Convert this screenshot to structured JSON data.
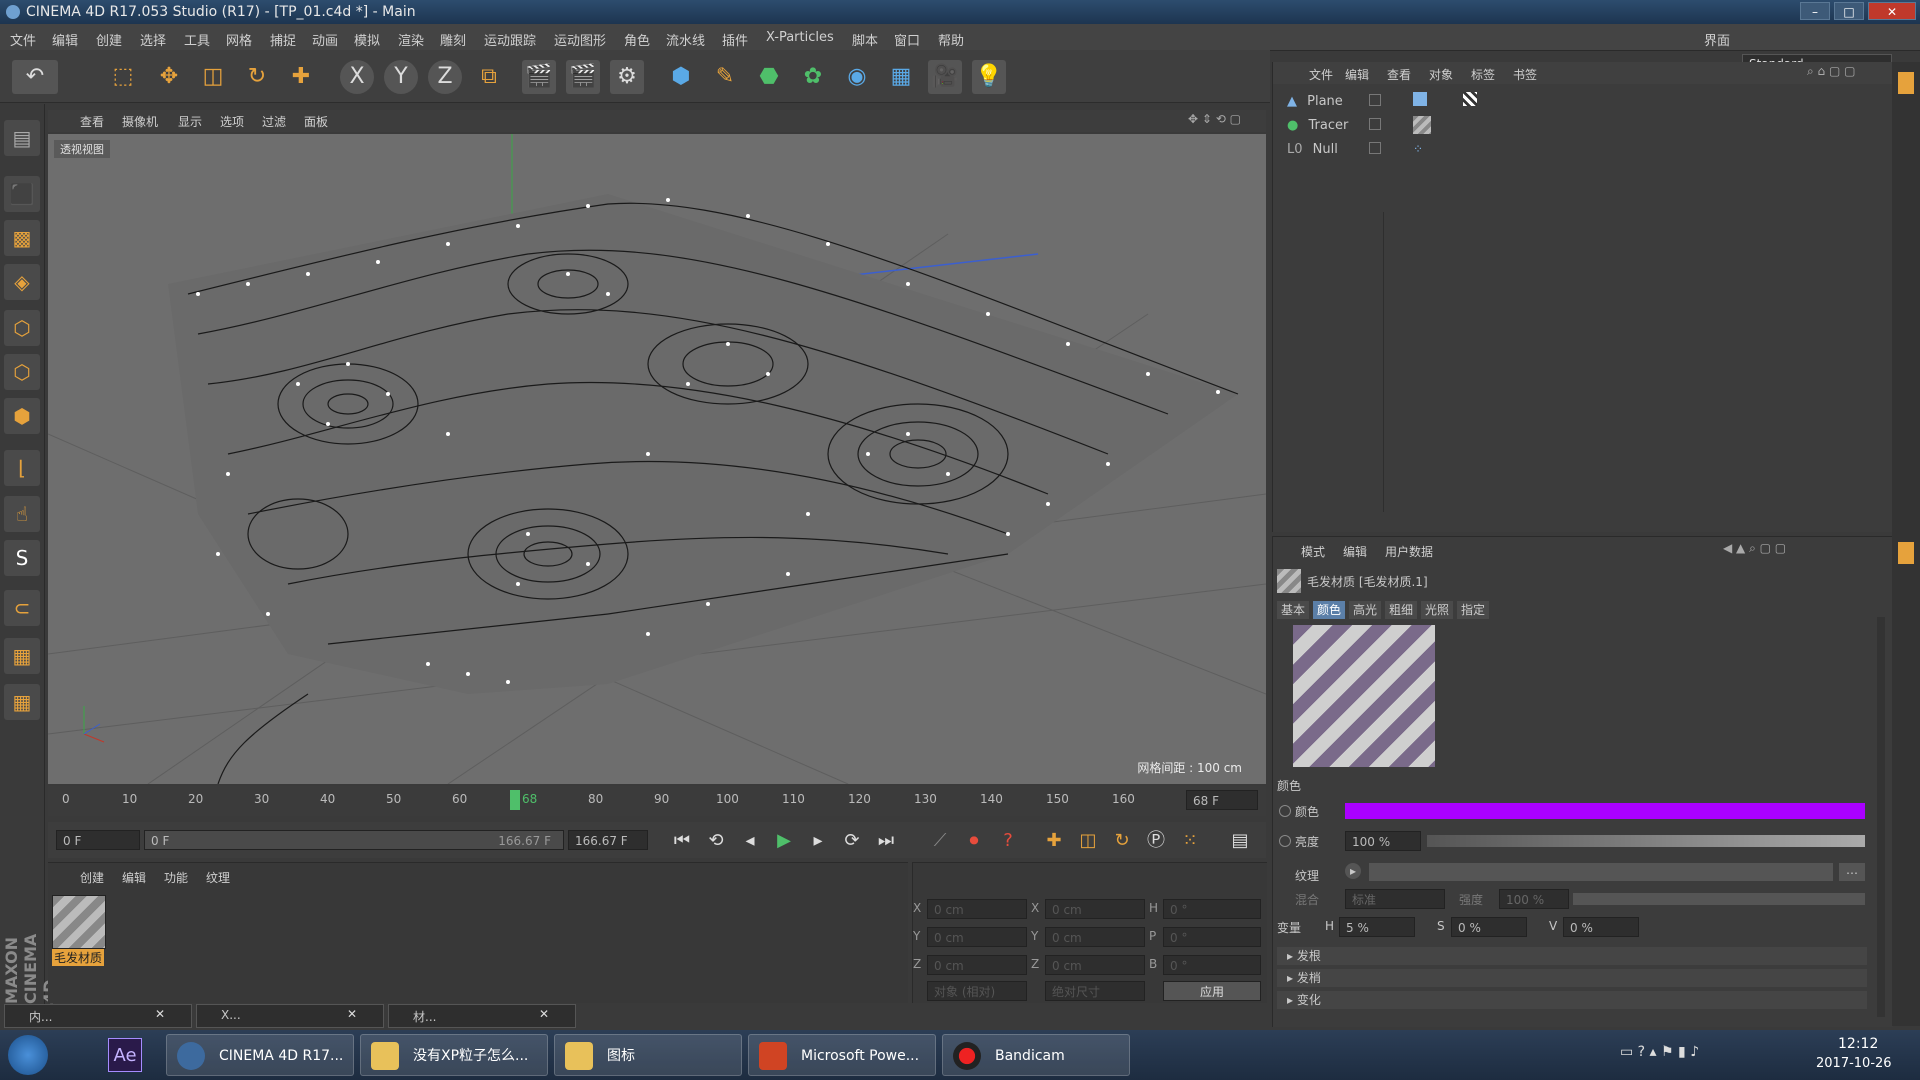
{
  "window": {
    "title": "CINEMA 4D R17.053 Studio (R17) - [TP_01.c4d *] - Main",
    "layout_label": "界面",
    "layout_value": "Standard"
  },
  "menu": [
    "文件",
    "编辑",
    "创建",
    "选择",
    "工具",
    "网格",
    "捕捉",
    "动画",
    "模拟",
    "渲染",
    "雕刻",
    "运动跟踪",
    "运动图形",
    "角色",
    "流水线",
    "插件",
    "X-Particles",
    "脚本",
    "窗口",
    "帮助"
  ],
  "viewport": {
    "menu": [
      "查看",
      "摄像机",
      "显示",
      "选项",
      "过滤",
      "面板"
    ],
    "label": "透视视图",
    "grid_info": "网格间距 : 100 cm"
  },
  "timeline": {
    "ticks": [
      "0",
      "10",
      "20",
      "30",
      "40",
      "50",
      "60",
      "68",
      "80",
      "90",
      "100",
      "110",
      "120",
      "130",
      "140",
      "150",
      "160"
    ],
    "end_frame": "68 F",
    "current": "0 F",
    "range_left": "0 F",
    "range_right": "166.67 F",
    "range_end": "166.67 F"
  },
  "material_manager": {
    "menu": [
      "创建",
      "编辑",
      "功能",
      "纹理"
    ],
    "material_name": "毛发材质"
  },
  "coords": {
    "labels": [
      "X",
      "Y",
      "Z",
      "X",
      "Y",
      "Z",
      "H",
      "P",
      "B"
    ],
    "values": [
      "0 cm",
      "0 cm",
      "0 cm",
      "0 cm",
      "0 cm",
      "0 cm",
      "0 °",
      "0 °",
      "0 °"
    ],
    "buttons": [
      "对象 (相对)",
      "绝对尺寸",
      "应用"
    ]
  },
  "object_manager": {
    "menu": [
      "文件",
      "编辑",
      "查看",
      "对象",
      "标签",
      "书签"
    ],
    "objects": [
      {
        "name": "Plane"
      },
      {
        "name": "Tracer"
      },
      {
        "name": "Null"
      }
    ]
  },
  "attribute_manager": {
    "menu": [
      "模式",
      "编辑",
      "用户数据"
    ],
    "title": "毛发材质 [毛发材质.1]",
    "tabs": [
      "基本",
      "颜色",
      "高光",
      "粗细",
      "光照",
      "指定"
    ],
    "section": "颜色",
    "color_label": "颜色",
    "color_hex": "#aa00ff",
    "brightness_label": "亮度",
    "brightness_value": "100 %",
    "texture_label": "纹理",
    "mix_label": "混合",
    "mix_mode": "标准",
    "strength_label": "强度",
    "strength_value": "100 %",
    "variation_label": "变量",
    "h_label": "H",
    "h_value": "5 %",
    "s_label": "S",
    "s_value": "0 %",
    "v_label": "V",
    "v_value": "0 %",
    "collapsed": [
      "发根",
      "发梢",
      "变化"
    ]
  },
  "bottom_windows": [
    "内...",
    "X...",
    "材..."
  ],
  "taskbar": {
    "tasks": [
      "CINEMA 4D R17...",
      "没有XP粒子怎么...",
      "图标",
      "Microsoft Powe...",
      "Bandicam"
    ],
    "time": "12:12",
    "date": "2017-10-26"
  }
}
